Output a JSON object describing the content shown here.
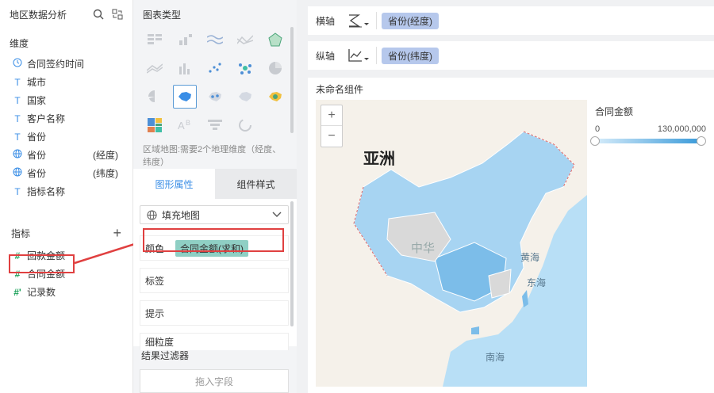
{
  "left_panel": {
    "title": "地区数据分析",
    "dimensions_title": "维度",
    "dimensions": [
      {
        "type": "clock",
        "label": "合同签约时间",
        "suffix": ""
      },
      {
        "type": "text",
        "label": "城市",
        "suffix": ""
      },
      {
        "type": "text",
        "label": "国家",
        "suffix": ""
      },
      {
        "type": "text",
        "label": "客户名称",
        "suffix": ""
      },
      {
        "type": "text",
        "label": "省份",
        "suffix": ""
      },
      {
        "type": "globe",
        "label": "省份",
        "suffix": "(经度)"
      },
      {
        "type": "globe",
        "label": "省份",
        "suffix": "(纬度)"
      },
      {
        "type": "text",
        "label": "指标名称",
        "suffix": ""
      }
    ],
    "measures_title": "指标",
    "add_symbol": "+",
    "measures": [
      {
        "icon": "#",
        "label": "回款金额"
      },
      {
        "icon": "#",
        "label": "合同金额"
      },
      {
        "icon": "#'",
        "label": "记录数"
      }
    ]
  },
  "middle_panel": {
    "chart_type_title": "图表类型",
    "hint": "区域地图:需要2个地理维度（经度、纬度）",
    "tabs": [
      "图形属性",
      "组件样式"
    ],
    "map_type": "填充地图",
    "color_label": "颜色",
    "color_field": "合同金额(求和)",
    "label_label": "标签",
    "tooltip_label": "提示",
    "granularity_label": "细粒度",
    "filter_title": "结果过滤器",
    "drop_hint": "拖入字段"
  },
  "right_panel": {
    "x_axis_label": "横轴",
    "x_axis_field": "省份(经度)",
    "y_axis_label": "纵轴",
    "y_axis_field": "省份(纬度)",
    "component_title": "未命名组件",
    "zoom_in": "+",
    "zoom_out": "−",
    "map_labels": {
      "asia": "亚洲",
      "china": "中华",
      "yellow_sea": "黄海",
      "east_sea": "东海",
      "south_sea": "南海"
    },
    "legend": {
      "title": "合同金额",
      "min": "0",
      "max": "130,000,000",
      "color_low": "#d6ecfa",
      "color_high": "#3a9ad9"
    }
  }
}
